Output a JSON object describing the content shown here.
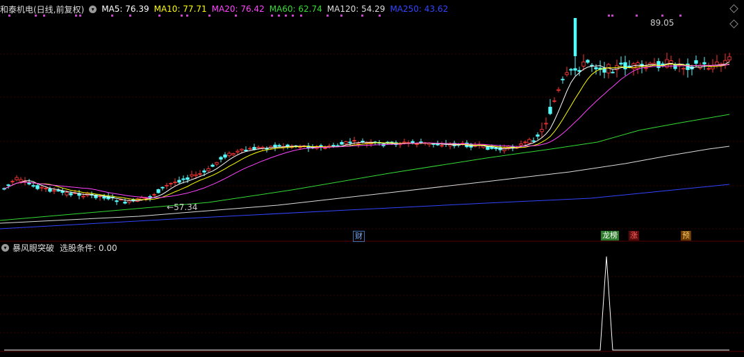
{
  "header": {
    "stock_title": "和泰机电(日线,前复权)",
    "ma": [
      {
        "label": "MA5: 76.39",
        "color": "#ffffff"
      },
      {
        "label": "MA10: 77.71",
        "color": "#ffff00"
      },
      {
        "label": "MA20: 76.42",
        "color": "#ff44ff"
      },
      {
        "label": "MA60: 62.74",
        "color": "#33dd33"
      },
      {
        "label": "MA120: 54.29",
        "color": "#dddddd"
      },
      {
        "label": "MA250: 43.62",
        "color": "#3344ff"
      }
    ]
  },
  "annotations": {
    "high_label": "89.05",
    "low_label": "57.34"
  },
  "markers": {
    "cai": "财",
    "longhu": "龙榜",
    "zhang": "涨",
    "yu": "预"
  },
  "indicator": {
    "title": "暴风眼突破",
    "condition": "选股条件: 0.00"
  },
  "colors": {
    "up": "#ff3333",
    "down": "#54ffff",
    "background": "#000000",
    "grid": "#3a0000"
  }
}
